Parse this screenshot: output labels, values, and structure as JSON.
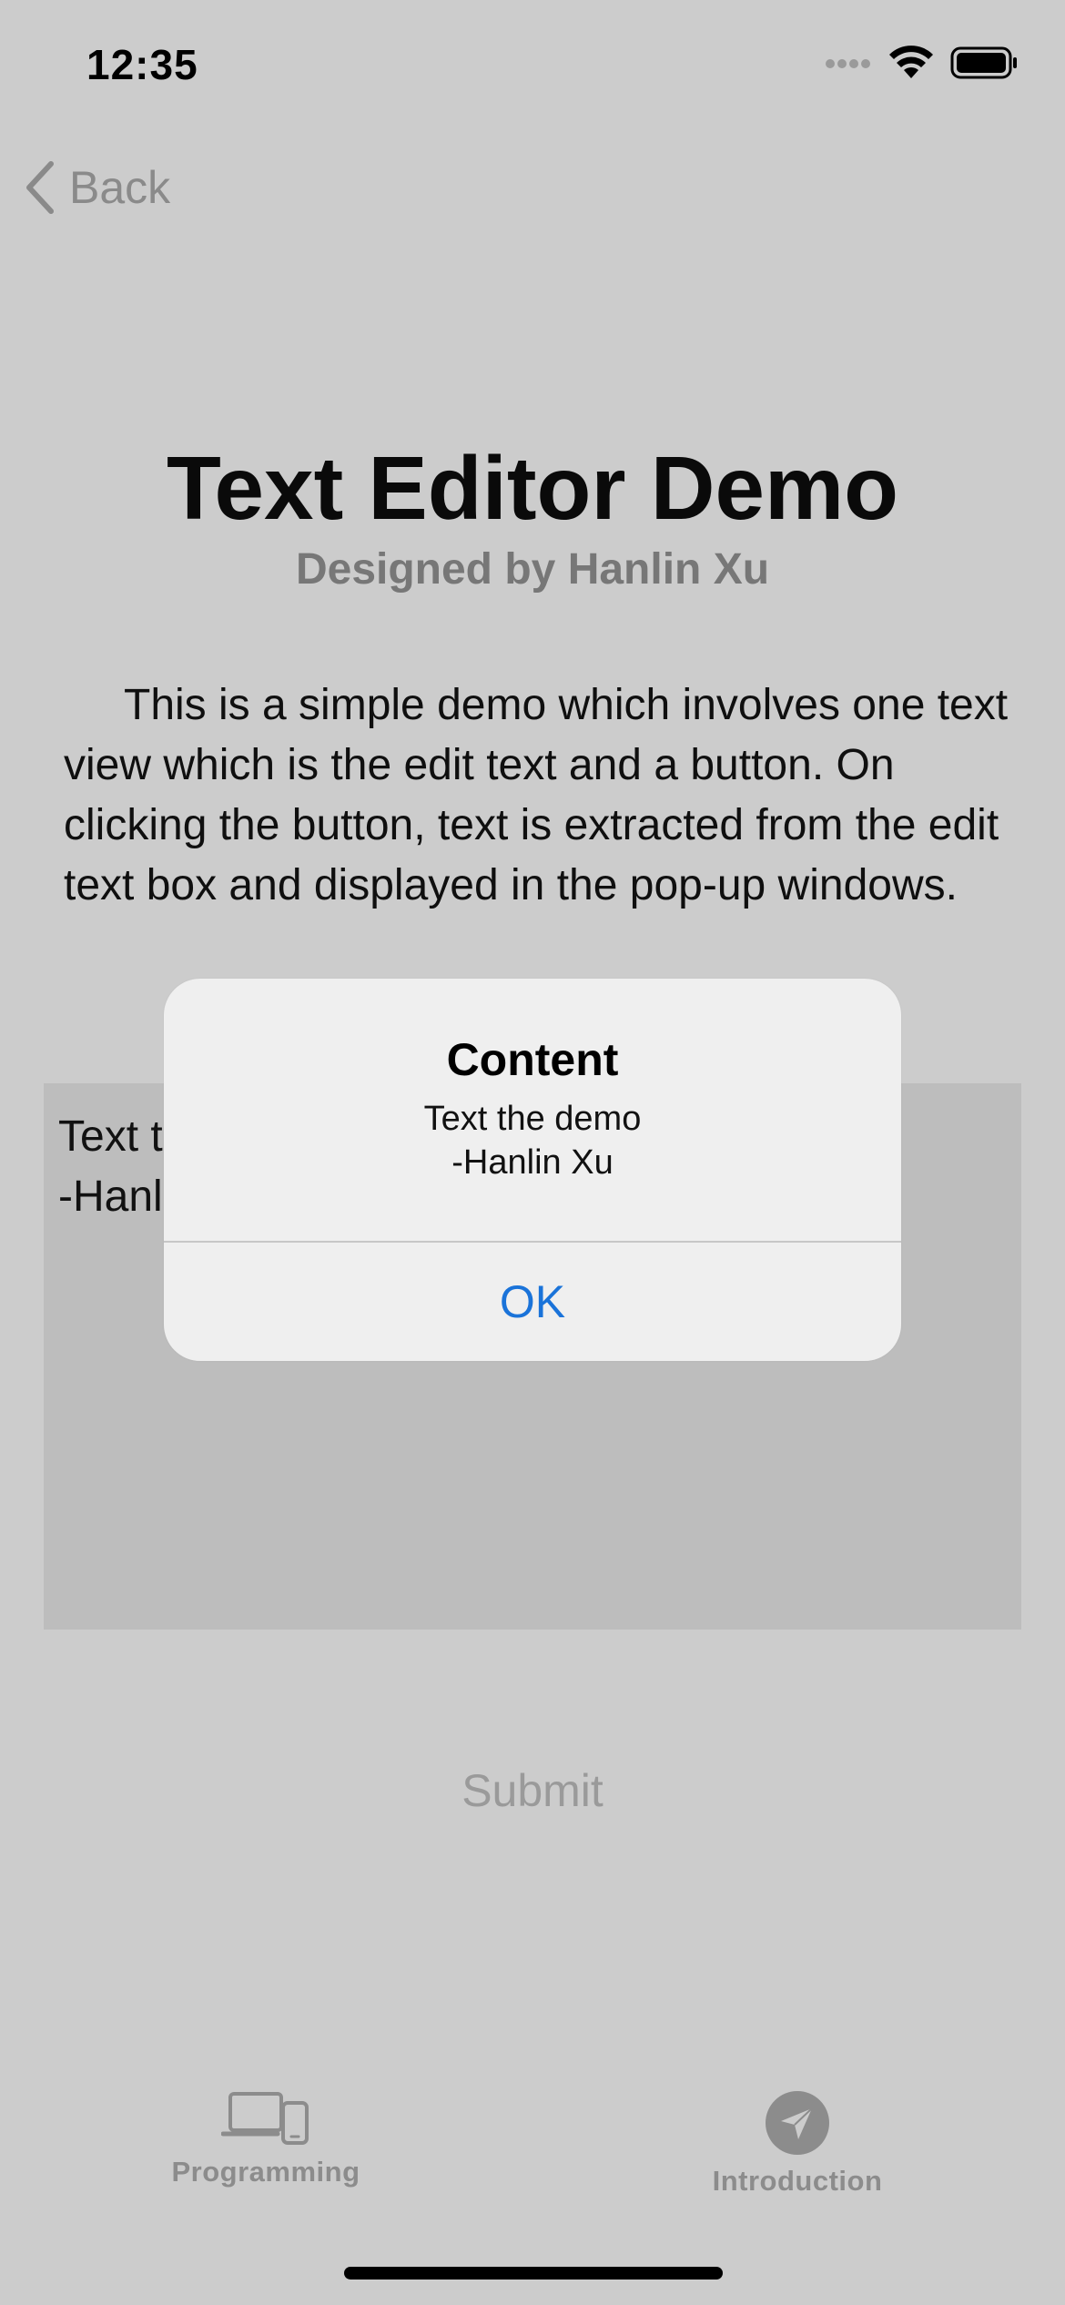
{
  "status_bar": {
    "time": "12:35",
    "icons": [
      "signal-icon",
      "wifi-icon",
      "battery-icon"
    ]
  },
  "nav": {
    "back_label": "Back"
  },
  "header": {
    "title": "Text Editor Demo",
    "subtitle": "Designed by Hanlin Xu"
  },
  "description": "This is a simple demo which involves one text view which is the edit text and a button. On clicking the button, text is extracted from the edit text box and displayed in the pop-up windows.",
  "editor": {
    "text": "Text the demo\n-Hanlin Xu"
  },
  "submit_label": "Submit",
  "alert": {
    "title": "Content",
    "message": "Text the demo\n-Hanlin Xu",
    "ok_label": "OK"
  },
  "tab_bar": {
    "tabs": [
      {
        "label": "Programming",
        "icon": "devices-icon"
      },
      {
        "label": "Introduction",
        "icon": "send-icon"
      }
    ]
  },
  "colors": {
    "background": "#cccccc",
    "editor_background": "#bdbdbd",
    "alert_background": "#efefef",
    "accent": "#1a73d9"
  }
}
